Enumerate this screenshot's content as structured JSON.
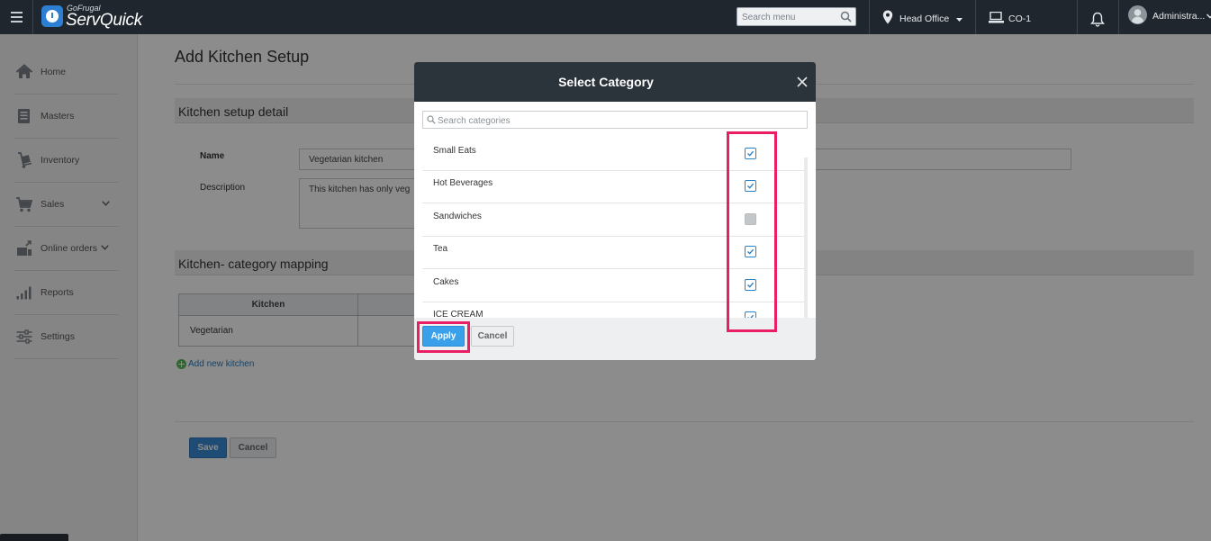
{
  "app": {
    "logo_small": "GoFrugal",
    "logo_big": "ServQuick"
  },
  "topbar": {
    "search_placeholder": "Search menu",
    "location": "Head Office",
    "counter": "CO-1",
    "user": "Administra..."
  },
  "sidebar": {
    "items": [
      {
        "label": "Home",
        "icon": "home-icon"
      },
      {
        "label": "Masters",
        "icon": "masters-icon"
      },
      {
        "label": "Inventory",
        "icon": "inventory-icon"
      },
      {
        "label": "Sales",
        "icon": "cart-icon",
        "has_chevron": true
      },
      {
        "label": "Online orders",
        "icon": "online-orders-icon",
        "has_chevron": true
      },
      {
        "label": "Reports",
        "icon": "reports-icon"
      },
      {
        "label": "Settings",
        "icon": "settings-icon"
      }
    ]
  },
  "page": {
    "title": "Add Kitchen Setup",
    "section_detail": "Kitchen setup detail",
    "name_label": "Name",
    "name_value": "Vegetarian kitchen",
    "description_label": "Description",
    "description_value": "This kitchen has only veg",
    "section_mapping": "Kitchen- category mapping",
    "table_header_kitchen": "Kitchen",
    "table_row_kitchen": "Vegetarian",
    "add_kitchen_label": "Add new kitchen",
    "save_label": "Save",
    "cancel_label": "Cancel"
  },
  "modal": {
    "title": "Select Category",
    "search_placeholder": "Search categories",
    "categories": [
      {
        "name": "Small Eats",
        "checked": true
      },
      {
        "name": "Hot Beverages",
        "checked": true
      },
      {
        "name": "Sandwiches",
        "checked": false
      },
      {
        "name": "Tea",
        "checked": true
      },
      {
        "name": "Cakes",
        "checked": true
      },
      {
        "name": "ICE CREAM",
        "checked": true
      }
    ],
    "apply_label": "Apply",
    "cancel_label": "Cancel"
  },
  "colors": {
    "topbar": "#1f262d",
    "accent_blue": "#3a8ad6",
    "apply_blue": "#3aa0ea",
    "highlight": "#e91e63"
  }
}
